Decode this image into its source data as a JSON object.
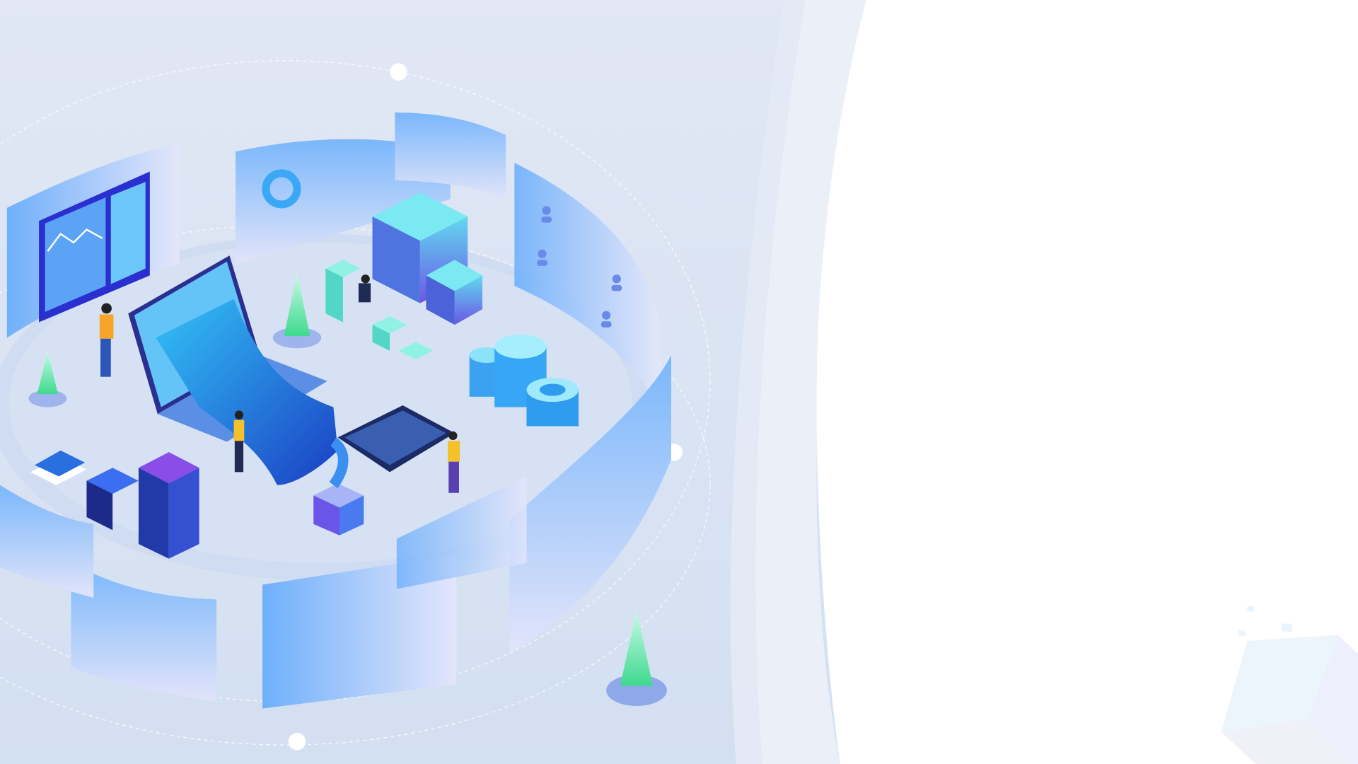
{
  "theme": {
    "background_left": "#dbe4f3",
    "background_right": "#ffffff",
    "accent_blue": "#5aa8f8",
    "accent_cyan": "#63e0e6",
    "accent_purple": "#7b5cf0",
    "tree_green": "#5ee8a8"
  },
  "illustration": {
    "icons": [
      "dashboard-panel-icon",
      "donut-chart-icon",
      "server-block-icon",
      "database-cylinder-icon",
      "laptop-icon",
      "user-card-icon",
      "book-stack-icon",
      "tree-icon",
      "robot-arm-icon",
      "tablet-icon",
      "pixel-cube-icon"
    ]
  }
}
